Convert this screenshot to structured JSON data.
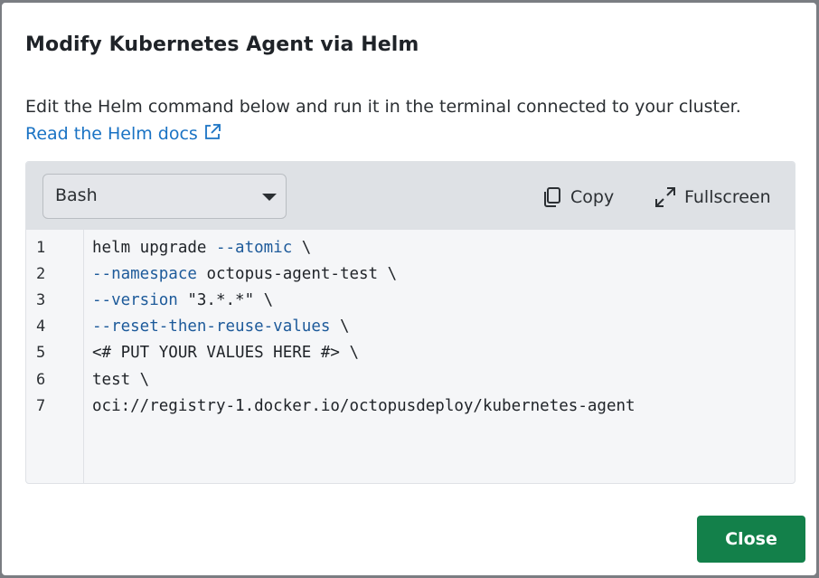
{
  "dialog": {
    "title": "Modify Kubernetes Agent via Helm",
    "description": "Edit the Helm command below and run it in the terminal connected to your cluster.",
    "docs_link": "Read the Helm docs",
    "close_label": "Close"
  },
  "code_panel": {
    "language_selected": "Bash",
    "copy_label": "Copy",
    "fullscreen_label": "Fullscreen",
    "icons": [
      "copy-icon",
      "fullscreen-icon",
      "external-link-icon",
      "chevron-down-icon"
    ],
    "lines": [
      {
        "num": "1",
        "plain1": "helm upgrade ",
        "kw": "--atomic",
        "plain2": " \\"
      },
      {
        "num": "2",
        "plain1": "",
        "kw": "--namespace",
        "plain2": " octopus-agent-test \\"
      },
      {
        "num": "3",
        "plain1": "",
        "kw": "--version",
        "plain2": " \"3.*.*\" \\"
      },
      {
        "num": "4",
        "plain1": "",
        "kw": "--reset-then-reuse-values",
        "plain2": " \\"
      },
      {
        "num": "5",
        "plain1": "<# PUT YOUR VALUES HERE #> \\",
        "kw": "",
        "plain2": ""
      },
      {
        "num": "6",
        "plain1": "test \\",
        "kw": "",
        "plain2": ""
      },
      {
        "num": "7",
        "plain1": "oci://registry-1.docker.io/octopusdeploy/kubernetes-agent",
        "kw": "",
        "plain2": ""
      }
    ]
  },
  "colors": {
    "link": "#1a73c4",
    "keyword": "#1d5a9a",
    "close_button": "#13804a",
    "toolbar_bg": "#dee1e5",
    "code_bg": "#f5f6f8"
  }
}
